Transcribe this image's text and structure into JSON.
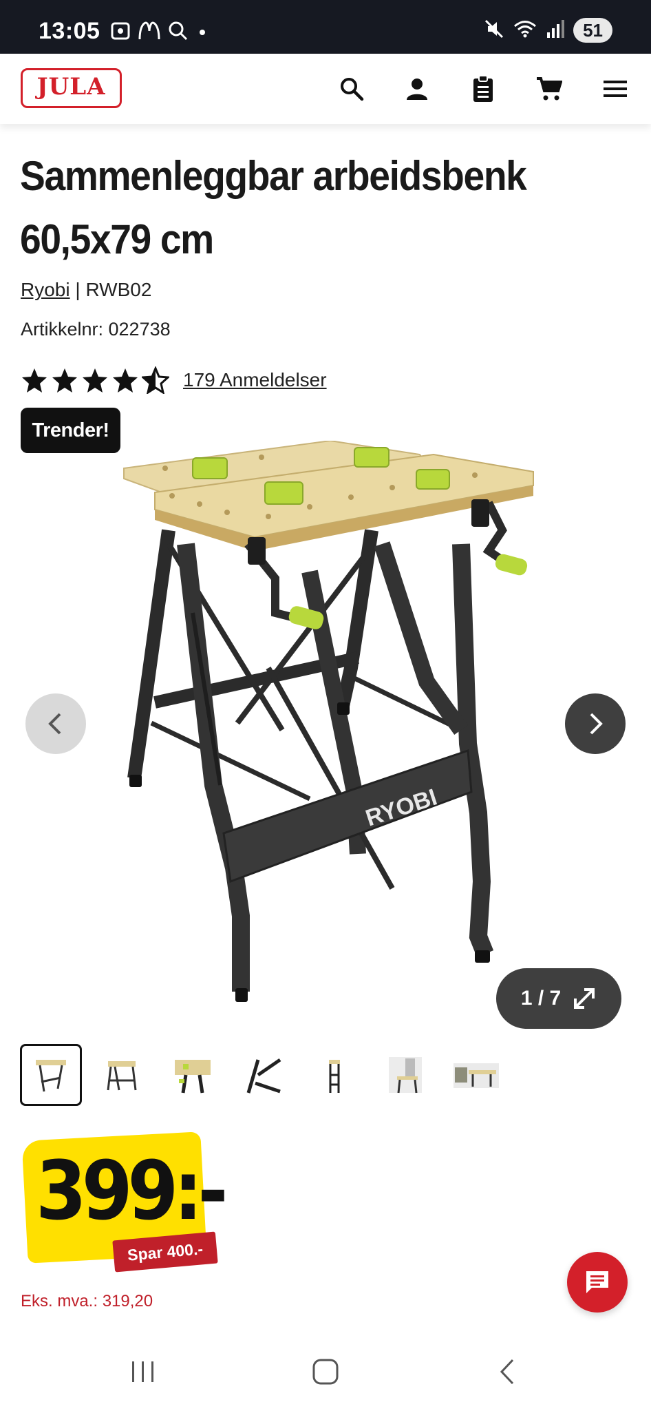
{
  "status_bar": {
    "time": "13:05",
    "battery": "51",
    "icons": [
      "screenshot-icon",
      "mcdonalds-icon",
      "search-icon",
      "dot-icon",
      "mute-icon",
      "wifi-icon",
      "signal-icon"
    ]
  },
  "header": {
    "logo_text": "JULA",
    "icons": [
      "search-icon",
      "account-icon",
      "clipboard-icon",
      "cart-icon",
      "menu-icon"
    ]
  },
  "product": {
    "title_line1": "Sammenleggbar arbeidsbenk",
    "title_line2": "60,5x79 cm",
    "brand": "Ryobi",
    "separator": "|",
    "model": "RWB02",
    "article_number": "Artikkelnr: 022738",
    "rating": 4.5,
    "reviews_text": "179 Anmeldelser",
    "badge": "Trender!",
    "image_brand_text": "RYOBI"
  },
  "gallery": {
    "counter": "1 / 7",
    "current": 1,
    "total": 7,
    "thumbnail_count": 7
  },
  "price": {
    "amount": "399:-",
    "savings": "Spar 400.-",
    "ex_vat": "Eks. mva.: 319,20"
  },
  "colors": {
    "brand_red": "#d3202a",
    "price_yellow": "#ffe000",
    "status_bar": "#161922",
    "dark_button": "#3f3f3f",
    "accent_green": "#b8d83c"
  }
}
